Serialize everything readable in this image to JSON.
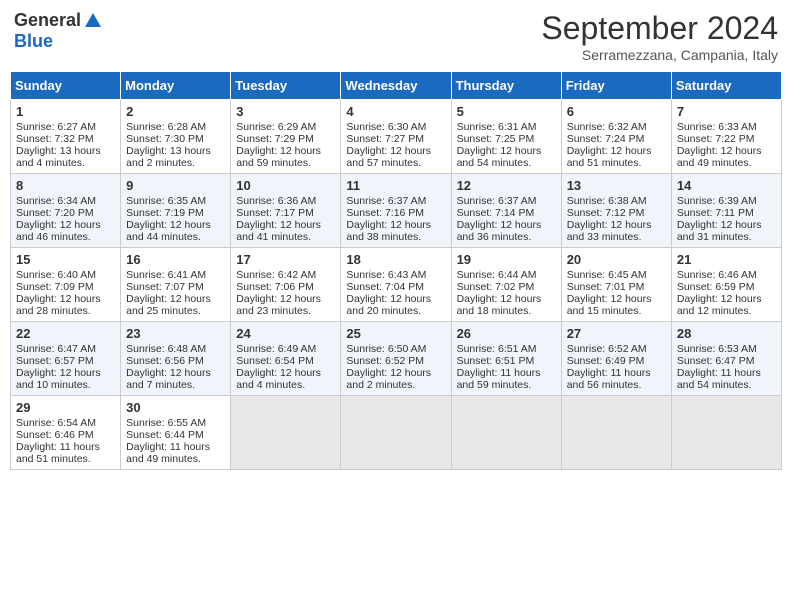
{
  "header": {
    "logo_general": "General",
    "logo_blue": "Blue",
    "month_title": "September 2024",
    "location": "Serramezzana, Campania, Italy"
  },
  "weekdays": [
    "Sunday",
    "Monday",
    "Tuesday",
    "Wednesday",
    "Thursday",
    "Friday",
    "Saturday"
  ],
  "weeks": [
    [
      {
        "day": "1",
        "lines": [
          "Sunrise: 6:27 AM",
          "Sunset: 7:32 PM",
          "Daylight: 13 hours",
          "and 4 minutes."
        ]
      },
      {
        "day": "2",
        "lines": [
          "Sunrise: 6:28 AM",
          "Sunset: 7:30 PM",
          "Daylight: 13 hours",
          "and 2 minutes."
        ]
      },
      {
        "day": "3",
        "lines": [
          "Sunrise: 6:29 AM",
          "Sunset: 7:29 PM",
          "Daylight: 12 hours",
          "and 59 minutes."
        ]
      },
      {
        "day": "4",
        "lines": [
          "Sunrise: 6:30 AM",
          "Sunset: 7:27 PM",
          "Daylight: 12 hours",
          "and 57 minutes."
        ]
      },
      {
        "day": "5",
        "lines": [
          "Sunrise: 6:31 AM",
          "Sunset: 7:25 PM",
          "Daylight: 12 hours",
          "and 54 minutes."
        ]
      },
      {
        "day": "6",
        "lines": [
          "Sunrise: 6:32 AM",
          "Sunset: 7:24 PM",
          "Daylight: 12 hours",
          "and 51 minutes."
        ]
      },
      {
        "day": "7",
        "lines": [
          "Sunrise: 6:33 AM",
          "Sunset: 7:22 PM",
          "Daylight: 12 hours",
          "and 49 minutes."
        ]
      }
    ],
    [
      {
        "day": "8",
        "lines": [
          "Sunrise: 6:34 AM",
          "Sunset: 7:20 PM",
          "Daylight: 12 hours",
          "and 46 minutes."
        ]
      },
      {
        "day": "9",
        "lines": [
          "Sunrise: 6:35 AM",
          "Sunset: 7:19 PM",
          "Daylight: 12 hours",
          "and 44 minutes."
        ]
      },
      {
        "day": "10",
        "lines": [
          "Sunrise: 6:36 AM",
          "Sunset: 7:17 PM",
          "Daylight: 12 hours",
          "and 41 minutes."
        ]
      },
      {
        "day": "11",
        "lines": [
          "Sunrise: 6:37 AM",
          "Sunset: 7:16 PM",
          "Daylight: 12 hours",
          "and 38 minutes."
        ]
      },
      {
        "day": "12",
        "lines": [
          "Sunrise: 6:37 AM",
          "Sunset: 7:14 PM",
          "Daylight: 12 hours",
          "and 36 minutes."
        ]
      },
      {
        "day": "13",
        "lines": [
          "Sunrise: 6:38 AM",
          "Sunset: 7:12 PM",
          "Daylight: 12 hours",
          "and 33 minutes."
        ]
      },
      {
        "day": "14",
        "lines": [
          "Sunrise: 6:39 AM",
          "Sunset: 7:11 PM",
          "Daylight: 12 hours",
          "and 31 minutes."
        ]
      }
    ],
    [
      {
        "day": "15",
        "lines": [
          "Sunrise: 6:40 AM",
          "Sunset: 7:09 PM",
          "Daylight: 12 hours",
          "and 28 minutes."
        ]
      },
      {
        "day": "16",
        "lines": [
          "Sunrise: 6:41 AM",
          "Sunset: 7:07 PM",
          "Daylight: 12 hours",
          "and 25 minutes."
        ]
      },
      {
        "day": "17",
        "lines": [
          "Sunrise: 6:42 AM",
          "Sunset: 7:06 PM",
          "Daylight: 12 hours",
          "and 23 minutes."
        ]
      },
      {
        "day": "18",
        "lines": [
          "Sunrise: 6:43 AM",
          "Sunset: 7:04 PM",
          "Daylight: 12 hours",
          "and 20 minutes."
        ]
      },
      {
        "day": "19",
        "lines": [
          "Sunrise: 6:44 AM",
          "Sunset: 7:02 PM",
          "Daylight: 12 hours",
          "and 18 minutes."
        ]
      },
      {
        "day": "20",
        "lines": [
          "Sunrise: 6:45 AM",
          "Sunset: 7:01 PM",
          "Daylight: 12 hours",
          "and 15 minutes."
        ]
      },
      {
        "day": "21",
        "lines": [
          "Sunrise: 6:46 AM",
          "Sunset: 6:59 PM",
          "Daylight: 12 hours",
          "and 12 minutes."
        ]
      }
    ],
    [
      {
        "day": "22",
        "lines": [
          "Sunrise: 6:47 AM",
          "Sunset: 6:57 PM",
          "Daylight: 12 hours",
          "and 10 minutes."
        ]
      },
      {
        "day": "23",
        "lines": [
          "Sunrise: 6:48 AM",
          "Sunset: 6:56 PM",
          "Daylight: 12 hours",
          "and 7 minutes."
        ]
      },
      {
        "day": "24",
        "lines": [
          "Sunrise: 6:49 AM",
          "Sunset: 6:54 PM",
          "Daylight: 12 hours",
          "and 4 minutes."
        ]
      },
      {
        "day": "25",
        "lines": [
          "Sunrise: 6:50 AM",
          "Sunset: 6:52 PM",
          "Daylight: 12 hours",
          "and 2 minutes."
        ]
      },
      {
        "day": "26",
        "lines": [
          "Sunrise: 6:51 AM",
          "Sunset: 6:51 PM",
          "Daylight: 11 hours",
          "and 59 minutes."
        ]
      },
      {
        "day": "27",
        "lines": [
          "Sunrise: 6:52 AM",
          "Sunset: 6:49 PM",
          "Daylight: 11 hours",
          "and 56 minutes."
        ]
      },
      {
        "day": "28",
        "lines": [
          "Sunrise: 6:53 AM",
          "Sunset: 6:47 PM",
          "Daylight: 11 hours",
          "and 54 minutes."
        ]
      }
    ],
    [
      {
        "day": "29",
        "lines": [
          "Sunrise: 6:54 AM",
          "Sunset: 6:46 PM",
          "Daylight: 11 hours",
          "and 51 minutes."
        ]
      },
      {
        "day": "30",
        "lines": [
          "Sunrise: 6:55 AM",
          "Sunset: 6:44 PM",
          "Daylight: 11 hours",
          "and 49 minutes."
        ]
      },
      {
        "day": "",
        "lines": []
      },
      {
        "day": "",
        "lines": []
      },
      {
        "day": "",
        "lines": []
      },
      {
        "day": "",
        "lines": []
      },
      {
        "day": "",
        "lines": []
      }
    ]
  ]
}
